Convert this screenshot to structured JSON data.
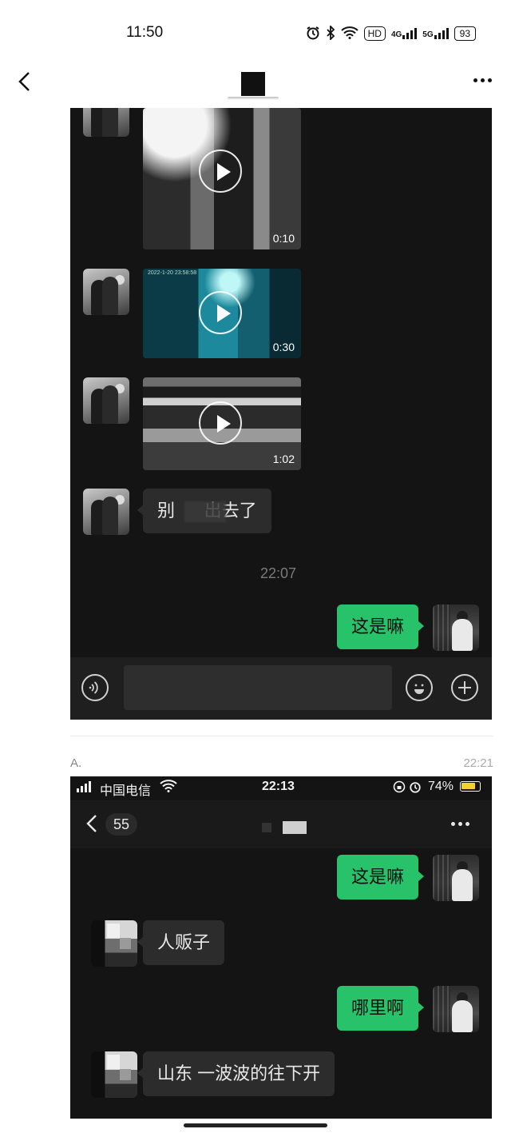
{
  "status_bar": {
    "time": "11:50",
    "hd_badge": "HD",
    "net1": "4G",
    "net2": "5G",
    "battery": "93"
  },
  "nav": {
    "back_icon": "chevron-left-icon",
    "more_icon": "more-dots-icon"
  },
  "chat1": {
    "videos": [
      {
        "duration": "0:10"
      },
      {
        "duration": "0:30",
        "stamp": "2022-1-20 23:58:58"
      },
      {
        "duration": "1:02"
      }
    ],
    "messages": [
      {
        "text": "别      出去了",
        "from": "other"
      },
      {
        "timestamp": "22:07"
      },
      {
        "text": "这是嘛",
        "from": "me"
      }
    ]
  },
  "post_meta": {
    "sender": "A.",
    "time": "22:21"
  },
  "chat2": {
    "status": {
      "carrier": "中国电信",
      "time": "22:13",
      "battery": "74%"
    },
    "nav": {
      "unread": "55",
      "more_icon": "more-dots-icon"
    },
    "messages": [
      {
        "text": "这是嘛",
        "from": "me"
      },
      {
        "text": "人贩子",
        "from": "other"
      },
      {
        "text": "哪里啊",
        "from": "me"
      },
      {
        "text": "山东 一波波的往下开",
        "from": "other"
      }
    ]
  },
  "colors": {
    "chat_bg": "#141414",
    "outgoing_bubble": "#27c26a",
    "incoming_bubble": "#2c2c2c"
  }
}
